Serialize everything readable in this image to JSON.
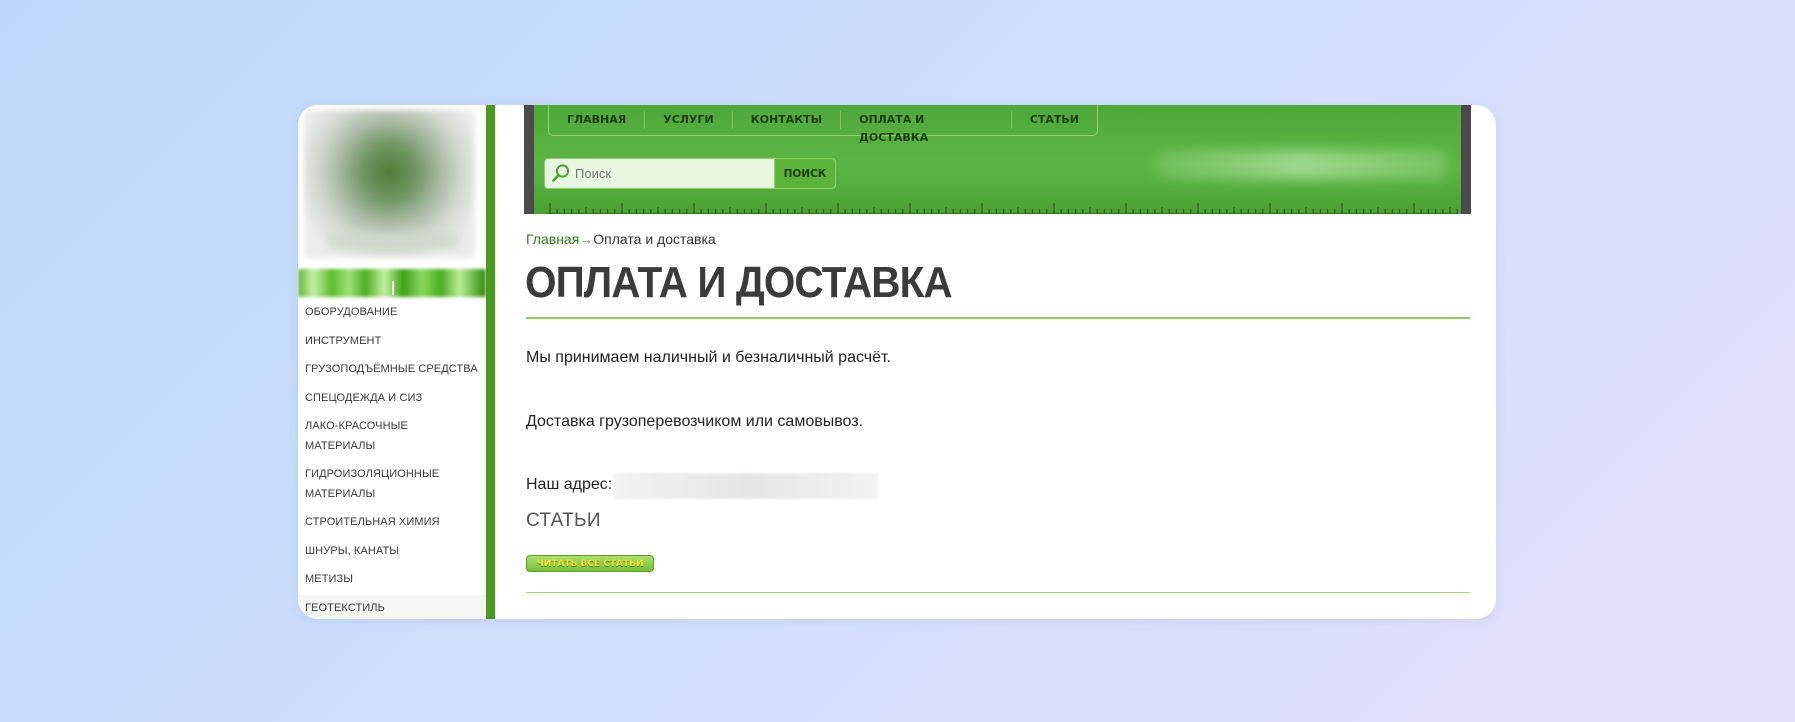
{
  "sidebar": {
    "categories": [
      "ОБОРУДОВАНИЕ",
      "ИНСТРУМЕНТ",
      "ГРУЗОПОДЪЁМНЫЕ СРЕДСТВА",
      "СПЕЦОДЕЖДА И СИЗ",
      "ЛАКО-КРАСОЧНЫЕ МАТЕРИАЛЫ",
      "ГИДРОИЗОЛЯЦИОННЫЕ МАТЕРИАЛЫ",
      "СТРОИТЕЛЬНАЯ ХИМИЯ",
      "ШНУРЫ, КАНАТЫ",
      "МЕТИЗЫ",
      "ГЕОТЕКСТИЛЬ"
    ]
  },
  "header": {
    "nav": [
      "ГЛАВНАЯ",
      "УСЛУГИ",
      "КОНТАКТЫ",
      "ОПЛАТА И ДОСТАВКА",
      "СТАТЬИ"
    ],
    "search": {
      "placeholder": "Поиск",
      "button_label": "ПОИСК"
    }
  },
  "breadcrumb": {
    "home": "Главная",
    "separator": "→",
    "current": "Оплата и доставка"
  },
  "main": {
    "title": "ОПЛАТА И ДОСТАВКА",
    "payment_text": "Мы принимаем наличный и безналичный расчёт.",
    "delivery_text": "Доставка грузоперевозчиком или самовывоз.",
    "address_label": "Наш адрес:",
    "articles_heading": "СТАТЬИ",
    "read_all_button": "ЧИТАТЬ ВСЕ СТАТЬИ"
  },
  "colors": {
    "accent_green": "#4a9a1e",
    "header_green": "#5cb544",
    "button_text_yellow": "#f6e13a"
  }
}
